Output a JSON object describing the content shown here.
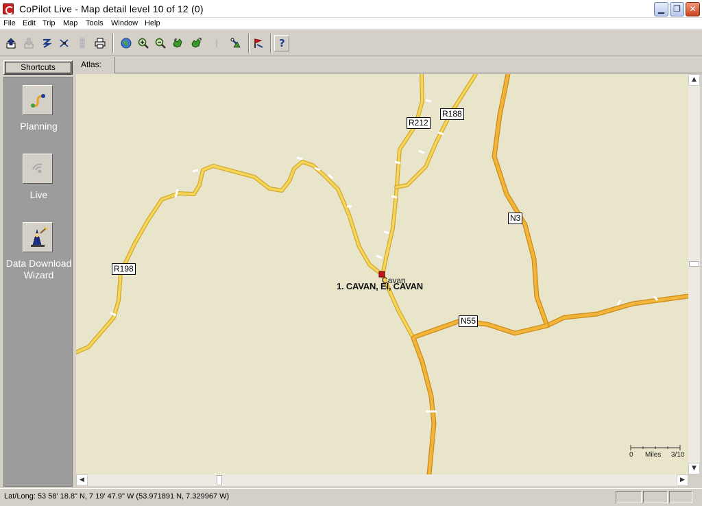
{
  "window": {
    "title": "CoPilot Live - Map detail level 10 of 12 (0)",
    "min_glyph": "▁",
    "max_glyph": "❐",
    "close_glyph": "✕"
  },
  "menu": [
    "File",
    "Edit",
    "Trip",
    "Map",
    "Tools",
    "Window",
    "Help"
  ],
  "toolbar": {
    "help_label": "?"
  },
  "sidebar": {
    "header": "Shortcuts",
    "items": [
      {
        "label": "Planning"
      },
      {
        "label": "Live"
      },
      {
        "label": "Data Download Wizard"
      }
    ]
  },
  "atlas": {
    "tab_label": "Atlas:"
  },
  "map": {
    "road_labels": {
      "r212": "R212",
      "r188": "R188",
      "n3": "N3",
      "r198": "R198",
      "n55": "N55"
    },
    "town_label": "Cavan",
    "result_label": "1. CAVAN, EI, CAVAN",
    "scale": {
      "start": "0",
      "unit": "Miles",
      "end": "3/10"
    },
    "colors": {
      "land": "#e9e5cb",
      "minor_road": "#f3cf45",
      "major_road": "#eea521",
      "marker": "#c8141e"
    }
  },
  "status": {
    "latlong": "Lat/Long:  53 58' 18.8\" N,    7 19' 47.9\" W (53.971891 N, 7.329967 W)"
  },
  "scroll": {
    "up": "▲",
    "down": "▼",
    "left": "◀",
    "right": "▶"
  }
}
